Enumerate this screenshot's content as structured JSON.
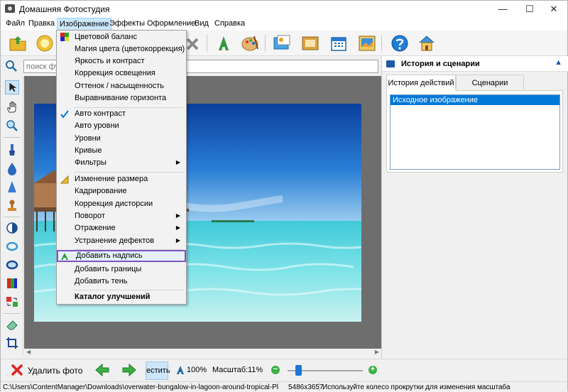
{
  "window": {
    "title": "Домашняя Фотостудия",
    "min": "—",
    "max": "☐",
    "close": "✕"
  },
  "menu": [
    "Файл",
    "Правка",
    "Изображение",
    "Эффекты",
    "Оформление",
    "Вид",
    "Справка"
  ],
  "active_menu": "Изображение",
  "dropdown": {
    "items": [
      "Цветовой баланс",
      "Магия цвета (цветокоррекция)",
      "Яркость и контраст",
      "Коррекция освещения",
      "Оттенок / насыщенность",
      "Выравнивание горизонта",
      "Авто контраст",
      "Авто уровни",
      "Уровни",
      "Кривые",
      "Фильтры",
      "Изменение размера",
      "Кадрирование",
      "Коррекция дисторсии",
      "Поворот",
      "Отражение",
      "Устранение дефектов",
      "Добавить надпись",
      "Добавить границы",
      "Добавить тень",
      "Каталог улучшений"
    ],
    "checked": "Авто контраст",
    "highlighted": "Добавить надпись",
    "submenu_arrow": "▶"
  },
  "search": {
    "placeholder": "поиск функций"
  },
  "right_panel": {
    "title": "История и сценарии",
    "pin": "▲",
    "tabs": [
      "История действий",
      "Сценарии"
    ],
    "history": [
      "Исходное изображение"
    ]
  },
  "bottom": {
    "delete_label": "Удалить фото",
    "fit_label": "естить",
    "zoom_100": "100%",
    "scale_label": "Масштаб:",
    "scale_value": "11%",
    "zoom_minus": "−",
    "zoom_plus": "+",
    "zoom_level": 0.14
  },
  "status": {
    "path": "C:\\Users\\ContentManager\\Downloads\\overwater-bungalow-in-lagoon-around-tropical-Pl",
    "size": "5486x3657",
    "hint": "Используйте колесо прокрутки для изменения масштаба"
  },
  "scroll": {
    "left": "◀",
    "right": "▶"
  },
  "colors": {
    "accent": "#0078d7",
    "highlight_border": "#7e54c2",
    "canvas_bg": "#6e6e6e"
  }
}
